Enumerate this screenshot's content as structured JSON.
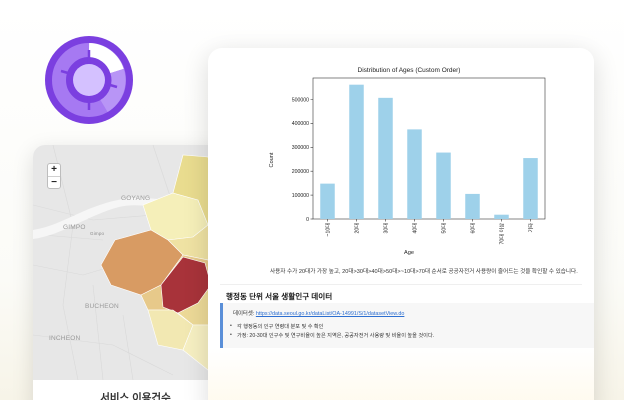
{
  "logo": {
    "icon": "donut-chart-icon",
    "colors": {
      "outer": "#7b3fe0",
      "ring": "#9c6cf0",
      "hub": "#d4c1ff",
      "white": "#ffffff"
    }
  },
  "map": {
    "zoom_in_label": "+",
    "zoom_out_label": "−",
    "place_labels": {
      "goyang": "GOYANG",
      "gimpo": "GIMPO",
      "bucheon": "BUCHEON",
      "incheon": "INCHEON",
      "small": "Gimpo"
    },
    "title": "서비스 이용건수",
    "colors": {
      "base": "#e7e7e7",
      "river": "#f6f6f6",
      "light": "#f5efb9",
      "yellow": "#e9dc8f",
      "orange": "#d89b63",
      "dark": "#a8333a"
    }
  },
  "chart_data": {
    "type": "bar",
    "title": "Distribution of Ages (Custom Order)",
    "xlabel": "Age",
    "ylabel": "Count",
    "categories": [
      "~10대",
      "20대",
      "30대",
      "40대",
      "50대",
      "60대",
      "70대 이상",
      "기타"
    ],
    "values": [
      148000,
      562000,
      507000,
      375000,
      278000,
      105000,
      18000,
      255000
    ],
    "ylim": [
      0,
      590000
    ],
    "yticks": [
      0,
      100000,
      200000,
      300000,
      400000,
      500000
    ],
    "ytick_labels": [
      "0",
      "100000",
      "200000",
      "300000",
      "400000",
      "500000"
    ],
    "bar_color": "#9ed1ea",
    "grid": false,
    "legend": "none"
  },
  "notebook": {
    "caption": "사용자 수가 20대가 가장 높고, 20대>30대>40대>50대>~10대>70대 순서로 공공자전거 사용량이 줄어드는 것을 확인할 수 있습니다.",
    "heading": "행정동 단위 서울 생활인구 데이터",
    "source_prefix": "데이터셋: ",
    "source_url": "https://data.seoul.go.kr/dataList/OA-14991/S/1/datasetView.do",
    "bullets": [
      "각 행정동의 인구 연령대 분포 및 수 확인",
      "가정: 20-30대 인구수 및 연구비율이 높은 지역은, 공공자전거 사용량 및 비율이 높을 것이다."
    ],
    "accent_color": "#5a8fd8"
  }
}
